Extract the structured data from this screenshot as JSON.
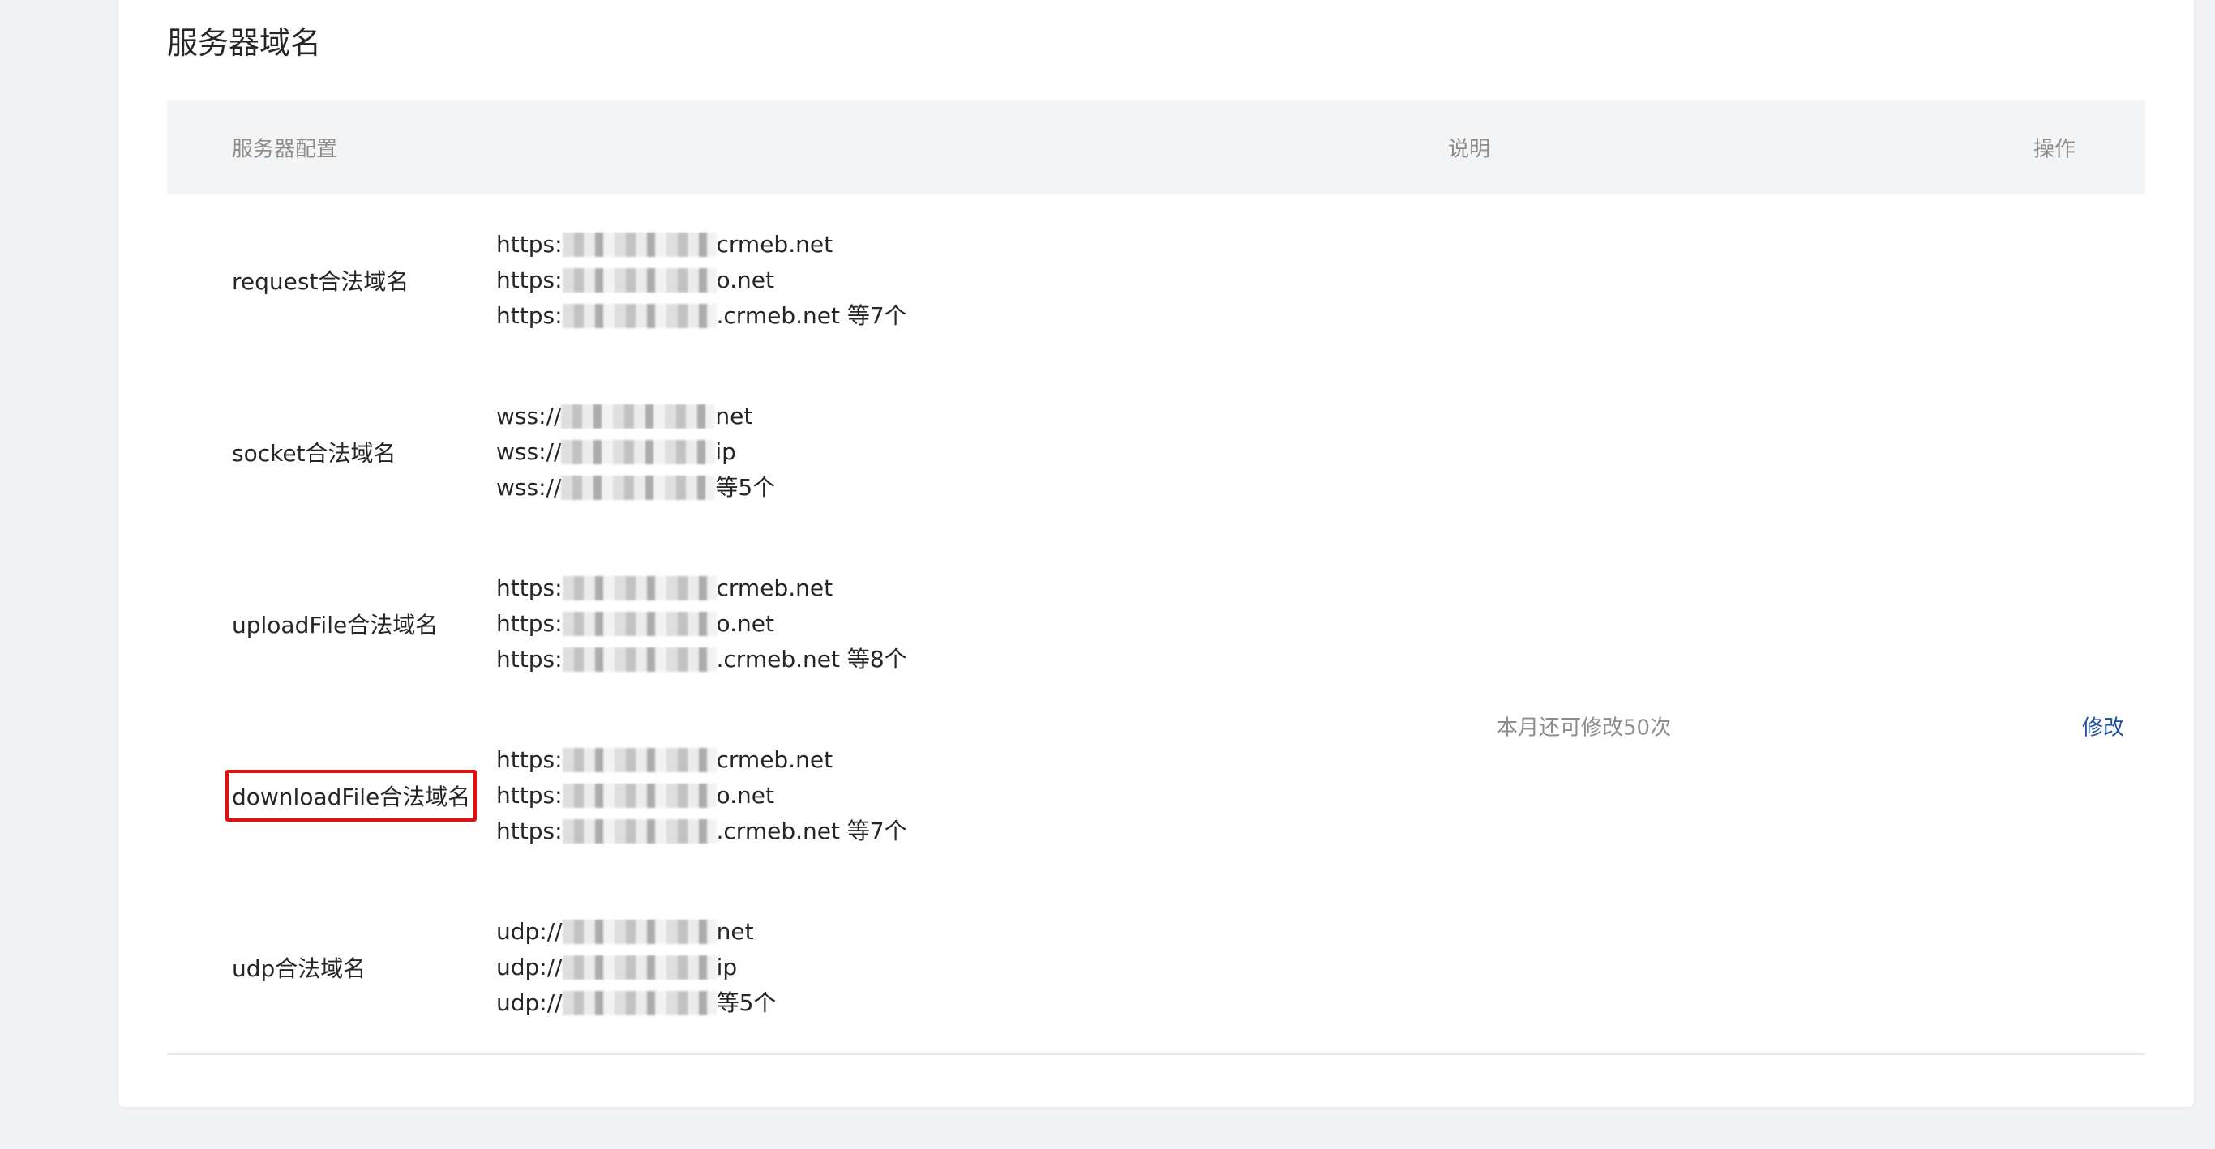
{
  "section": {
    "title": "服务器域名"
  },
  "table": {
    "headers": {
      "config": "服务器配置",
      "description": "说明",
      "action": "操作"
    },
    "rows": [
      {
        "label": "request合法域名",
        "domains": [
          {
            "prefix": "https:",
            "suffix": "crmeb.net"
          },
          {
            "prefix": "https:",
            "suffix": "o.net"
          },
          {
            "prefix": "https:",
            "suffix": ".crmeb.net 等7个"
          }
        ]
      },
      {
        "label": "socket合法域名",
        "domains": [
          {
            "prefix": "wss://",
            "suffix": "net"
          },
          {
            "prefix": "wss://",
            "suffix": "ip"
          },
          {
            "prefix": "wss://",
            "suffix": "等5个"
          }
        ]
      },
      {
        "label": "uploadFile合法域名",
        "domains": [
          {
            "prefix": "https:",
            "suffix": "crmeb.net"
          },
          {
            "prefix": "https:",
            "suffix": "o.net"
          },
          {
            "prefix": "https:",
            "suffix": ".crmeb.net 等8个"
          }
        ]
      },
      {
        "label": "downloadFile合法域名",
        "highlighted": true,
        "domains": [
          {
            "prefix": "https:",
            "suffix": "crmeb.net"
          },
          {
            "prefix": "https:",
            "suffix": "o.net"
          },
          {
            "prefix": "https:",
            "suffix": ".crmeb.net 等7个"
          }
        ]
      },
      {
        "label": "udp合法域名",
        "domains": [
          {
            "prefix": "udp://",
            "suffix": "net"
          },
          {
            "prefix": "udp://",
            "suffix": "ip"
          },
          {
            "prefix": "udp://",
            "suffix": "等5个"
          }
        ]
      }
    ],
    "description": "本月还可修改50次",
    "action_label": "修改"
  },
  "colors": {
    "highlight_border": "#e01010",
    "link": "#1d4e9e",
    "header_bg": "#f3f4f6"
  }
}
